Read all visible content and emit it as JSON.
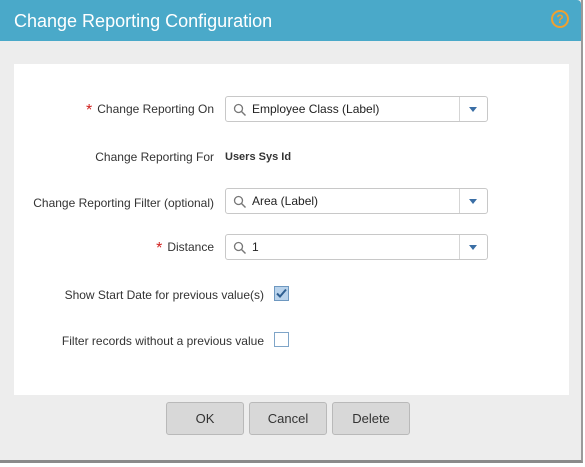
{
  "dialog": {
    "title": "Change Reporting Configuration",
    "help_icon": "help-icon",
    "help_glyph": "?"
  },
  "form": {
    "change_reporting_on": {
      "label": "Change Reporting On",
      "required": true,
      "value": "Employee Class (Label)"
    },
    "change_reporting_for": {
      "label": "Change Reporting For",
      "value": "Users Sys Id"
    },
    "change_reporting_filter": {
      "label": "Change Reporting Filter (optional)",
      "value": "Area (Label)"
    },
    "distance": {
      "label": "Distance",
      "required": true,
      "value": "1"
    },
    "show_start_date": {
      "label": "Show Start Date for previous value(s)",
      "checked": true
    },
    "filter_records": {
      "label": "Filter records without a previous value",
      "checked": false
    },
    "required_marker": "*"
  },
  "buttons": {
    "ok": "OK",
    "cancel": "Cancel",
    "delete": "Delete"
  },
  "colors": {
    "titlebar": "#4aa9c9",
    "accent_help": "#f0a030",
    "required": "#d0201e"
  }
}
